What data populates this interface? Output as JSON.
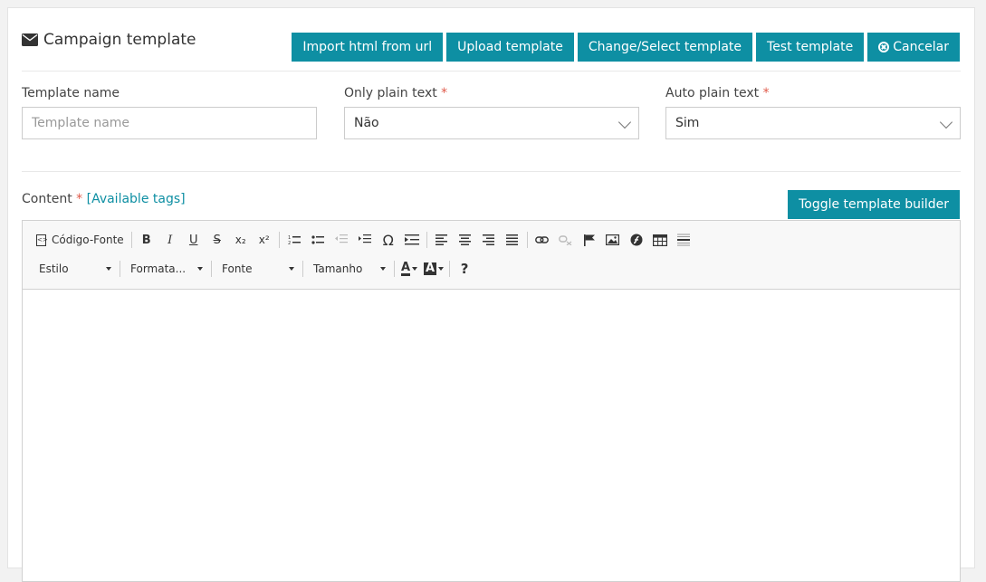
{
  "header": {
    "title": "Campaign template",
    "title_icon": "envelope-icon",
    "buttons": {
      "import_url": "Import html from url",
      "upload": "Upload template",
      "change_select": "Change/Select template",
      "test": "Test template",
      "cancel": "Cancelar"
    }
  },
  "form": {
    "template_name": {
      "label": "Template name",
      "placeholder": "Template name",
      "value": ""
    },
    "only_plain_text": {
      "label": "Only plain text",
      "required_mark": "*",
      "value": "Não"
    },
    "auto_plain_text": {
      "label": "Auto plain text",
      "required_mark": "*",
      "value": "Sim"
    }
  },
  "content": {
    "label": "Content",
    "required_mark": "*",
    "tags_open": "[",
    "tags_link": "Available tags",
    "tags_close": "]",
    "toggle_button": "Toggle template builder"
  },
  "editor": {
    "source_label": "Código-Fonte",
    "bold": "B",
    "italic": "I",
    "underline": "U",
    "strike": "S",
    "subscript": "x₂",
    "superscript": "x²",
    "special_char": "Ω",
    "help": "?",
    "text_color": "A",
    "bg_color": "A",
    "combos": {
      "style": "Estilo",
      "format": "Formata...",
      "font": "Fonte",
      "size": "Tamanho"
    }
  },
  "colors": {
    "accent": "#0e8fa3",
    "required": "#e05a4a"
  }
}
